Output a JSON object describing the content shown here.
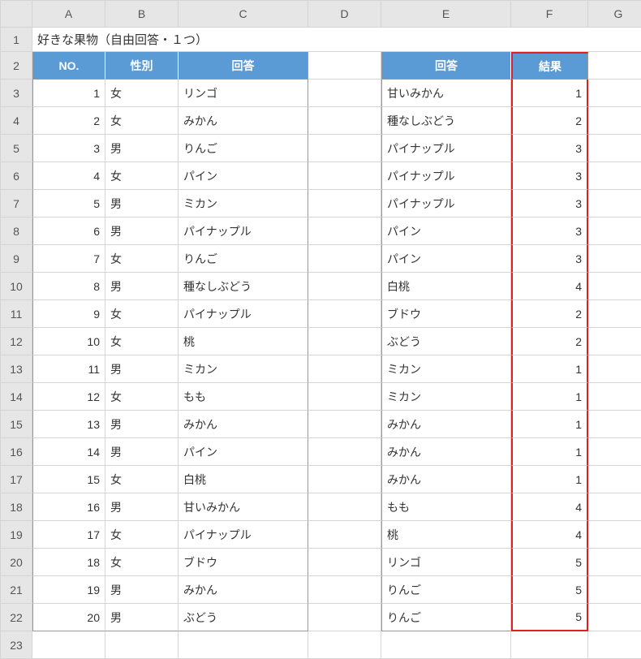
{
  "columns": [
    "A",
    "B",
    "C",
    "D",
    "E",
    "F",
    "G"
  ],
  "title": "好きな果物（自由回答・１つ）",
  "headers1": {
    "no": "NO.",
    "sex": "性別",
    "answer": "回答"
  },
  "headers2": {
    "answer": "回答",
    "result": "結果"
  },
  "table1": [
    {
      "no": 1,
      "sex": "女",
      "answer": "リンゴ"
    },
    {
      "no": 2,
      "sex": "女",
      "answer": "みかん"
    },
    {
      "no": 3,
      "sex": "男",
      "answer": "りんご"
    },
    {
      "no": 4,
      "sex": "女",
      "answer": "パイン"
    },
    {
      "no": 5,
      "sex": "男",
      "answer": "ミカン"
    },
    {
      "no": 6,
      "sex": "男",
      "answer": "パイナップル"
    },
    {
      "no": 7,
      "sex": "女",
      "answer": "りんご"
    },
    {
      "no": 8,
      "sex": "男",
      "answer": "種なしぶどう"
    },
    {
      "no": 9,
      "sex": "女",
      "answer": "パイナップル"
    },
    {
      "no": 10,
      "sex": "女",
      "answer": "桃"
    },
    {
      "no": 11,
      "sex": "男",
      "answer": "ミカン"
    },
    {
      "no": 12,
      "sex": "女",
      "answer": "もも"
    },
    {
      "no": 13,
      "sex": "男",
      "answer": "みかん"
    },
    {
      "no": 14,
      "sex": "男",
      "answer": "パイン"
    },
    {
      "no": 15,
      "sex": "女",
      "answer": "白桃"
    },
    {
      "no": 16,
      "sex": "男",
      "answer": "甘いみかん"
    },
    {
      "no": 17,
      "sex": "女",
      "answer": "パイナップル"
    },
    {
      "no": 18,
      "sex": "女",
      "answer": "ブドウ"
    },
    {
      "no": 19,
      "sex": "男",
      "answer": "みかん"
    },
    {
      "no": 20,
      "sex": "男",
      "answer": "ぶどう"
    }
  ],
  "table2": [
    {
      "answer": "甘いみかん",
      "result": 1
    },
    {
      "answer": "種なしぶどう",
      "result": 2
    },
    {
      "answer": "パイナップル",
      "result": 3
    },
    {
      "answer": "パイナップル",
      "result": 3
    },
    {
      "answer": "パイナップル",
      "result": 3
    },
    {
      "answer": "パイン",
      "result": 3
    },
    {
      "answer": "パイン",
      "result": 3
    },
    {
      "answer": "白桃",
      "result": 4
    },
    {
      "answer": "ブドウ",
      "result": 2
    },
    {
      "answer": "ぶどう",
      "result": 2
    },
    {
      "answer": "ミカン",
      "result": 1
    },
    {
      "answer": "ミカン",
      "result": 1
    },
    {
      "answer": "みかん",
      "result": 1
    },
    {
      "answer": "みかん",
      "result": 1
    },
    {
      "answer": "みかん",
      "result": 1
    },
    {
      "answer": "もも",
      "result": 4
    },
    {
      "answer": "桃",
      "result": 4
    },
    {
      "answer": "リンゴ",
      "result": 5
    },
    {
      "answer": "りんご",
      "result": 5
    },
    {
      "answer": "りんご",
      "result": 5
    }
  ],
  "total_rows": 23
}
